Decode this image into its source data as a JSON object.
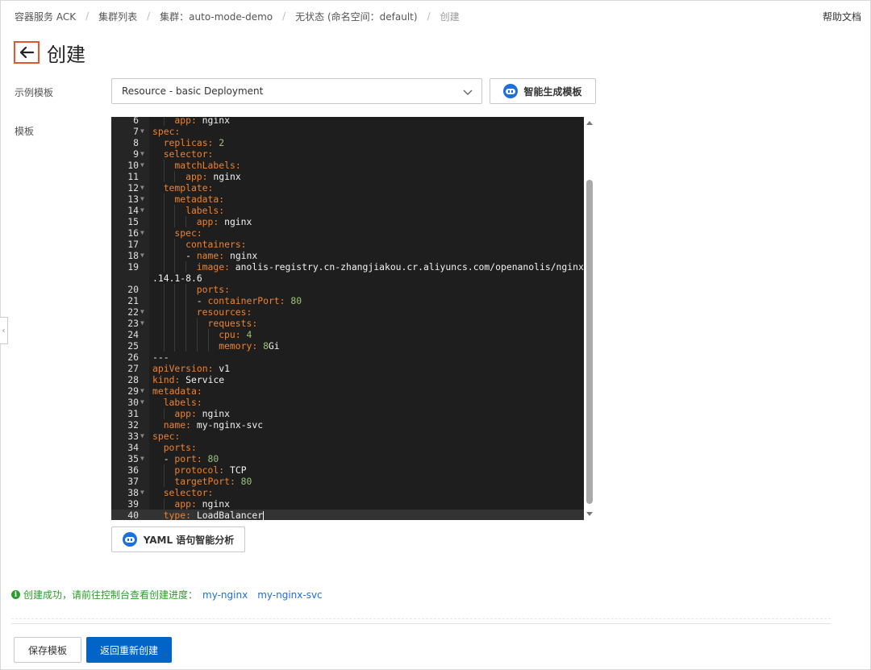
{
  "breadcrumb": {
    "items": [
      "容器服务 ACK",
      "集群列表",
      "集群：auto-mode-demo",
      "无状态 (命名空间：default)"
    ],
    "current": "创建"
  },
  "help_link": "帮助文档",
  "page": {
    "title": "创建"
  },
  "form": {
    "template_example_label": "示例模板",
    "template_example_value": "Resource - basic Deployment",
    "ai_generate_label": "智能生成模板",
    "template_label": "模板",
    "yaml_analyze_label": "YAML 语句智能分析"
  },
  "editor": {
    "lines": [
      {
        "n": "6",
        "fold": false,
        "indent": 2,
        "k": "app:",
        "v": " nginx"
      },
      {
        "n": "7",
        "fold": true,
        "indent": 0,
        "k": "spec:",
        "v": ""
      },
      {
        "n": "8",
        "fold": false,
        "indent": 1,
        "k": "replicas:",
        "v": " 2",
        "num": true
      },
      {
        "n": "9",
        "fold": true,
        "indent": 1,
        "k": "selector:",
        "v": ""
      },
      {
        "n": "10",
        "fold": true,
        "indent": 2,
        "k": "matchLabels:",
        "v": ""
      },
      {
        "n": "11",
        "fold": false,
        "indent": 3,
        "k": "app:",
        "v": " nginx"
      },
      {
        "n": "12",
        "fold": true,
        "indent": 1,
        "k": "template:",
        "v": ""
      },
      {
        "n": "13",
        "fold": true,
        "indent": 2,
        "k": "metadata:",
        "v": ""
      },
      {
        "n": "14",
        "fold": true,
        "indent": 3,
        "k": "labels:",
        "v": ""
      },
      {
        "n": "15",
        "fold": false,
        "indent": 4,
        "k": "app:",
        "v": " nginx"
      },
      {
        "n": "16",
        "fold": true,
        "indent": 2,
        "k": "spec:",
        "v": ""
      },
      {
        "n": "17",
        "fold": false,
        "indent": 3,
        "k": "containers:",
        "v": ""
      },
      {
        "n": "18",
        "fold": true,
        "indent": 3,
        "d": "- ",
        "k": "name:",
        "v": " nginx"
      },
      {
        "n": "19",
        "fold": false,
        "indent": 4,
        "k": "image:",
        "v": " anolis-registry.cn-zhangjiakou.cr.aliyuncs.com/openanolis/nginx:1"
      },
      {
        "n": "",
        "fold": false,
        "indent": -1,
        "k": "",
        "v": ".14.1-8.6"
      },
      {
        "n": "20",
        "fold": false,
        "indent": 4,
        "k": "ports:",
        "v": ""
      },
      {
        "n": "21",
        "fold": false,
        "indent": 4,
        "d": "- ",
        "k": "containerPort:",
        "v": " 80",
        "num": true
      },
      {
        "n": "22",
        "fold": true,
        "indent": 4,
        "k": "resources:",
        "v": ""
      },
      {
        "n": "23",
        "fold": true,
        "indent": 5,
        "k": "requests:",
        "v": ""
      },
      {
        "n": "24",
        "fold": false,
        "indent": 6,
        "k": "cpu:",
        "v": " 4",
        "num": true
      },
      {
        "n": "25",
        "fold": false,
        "indent": 6,
        "k": "memory:",
        "v": " 8Gi",
        "num8": true
      },
      {
        "n": "26",
        "fold": false,
        "indent": 0,
        "k": "",
        "v": "---"
      },
      {
        "n": "27",
        "fold": false,
        "indent": 0,
        "k": "apiVersion:",
        "v": " v1"
      },
      {
        "n": "28",
        "fold": false,
        "indent": 0,
        "k": "kind:",
        "v": " Service"
      },
      {
        "n": "29",
        "fold": true,
        "indent": 0,
        "k": "metadata:",
        "v": ""
      },
      {
        "n": "30",
        "fold": true,
        "indent": 1,
        "k": "labels:",
        "v": ""
      },
      {
        "n": "31",
        "fold": false,
        "indent": 2,
        "k": "app:",
        "v": " nginx"
      },
      {
        "n": "32",
        "fold": false,
        "indent": 1,
        "k": "name:",
        "v": " my-nginx-svc"
      },
      {
        "n": "33",
        "fold": true,
        "indent": 0,
        "k": "spec:",
        "v": ""
      },
      {
        "n": "34",
        "fold": false,
        "indent": 1,
        "k": "ports:",
        "v": ""
      },
      {
        "n": "35",
        "fold": true,
        "indent": 1,
        "d": "- ",
        "k": "port:",
        "v": " 80",
        "num": true
      },
      {
        "n": "36",
        "fold": false,
        "indent": 2,
        "k": "protocol:",
        "v": " TCP"
      },
      {
        "n": "37",
        "fold": false,
        "indent": 2,
        "k": "targetPort:",
        "v": " 80",
        "num": true
      },
      {
        "n": "38",
        "fold": true,
        "indent": 1,
        "k": "selector:",
        "v": ""
      },
      {
        "n": "39",
        "fold": false,
        "indent": 2,
        "k": "app:",
        "v": " nginx"
      },
      {
        "n": "40",
        "fold": false,
        "indent": 1,
        "k": "type:",
        "v": " LoadBalancer",
        "active": true
      }
    ]
  },
  "status": {
    "message": "创建成功，请前往控制台查看创建进度：",
    "links": [
      "my-nginx",
      "my-nginx-svc"
    ]
  },
  "footer": {
    "save_template": "保存模板",
    "recreate": "返回重新创建"
  }
}
